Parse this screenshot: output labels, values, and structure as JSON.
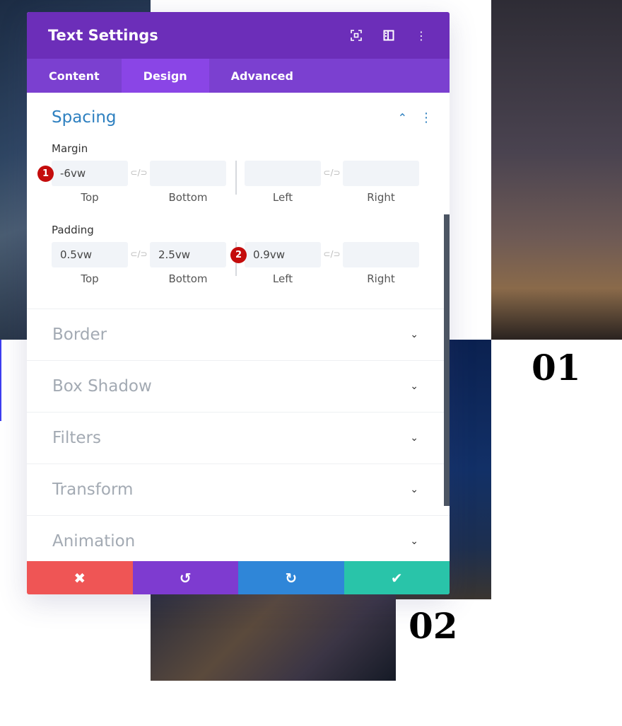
{
  "panel": {
    "title": "Text Settings",
    "header_icons": [
      "focus-icon",
      "split-view-icon",
      "more-options-icon"
    ]
  },
  "tabs": [
    {
      "label": "Content"
    },
    {
      "label": "Design",
      "active": true
    },
    {
      "label": "Advanced"
    }
  ],
  "spacing": {
    "title": "Spacing",
    "margin": {
      "label": "Margin",
      "top": "-6vw",
      "bottom": "",
      "left": "",
      "right": "",
      "badge": "1"
    },
    "padding": {
      "label": "Padding",
      "top": "0.5vw",
      "bottom": "2.5vw",
      "left": "0.9vw",
      "right": "",
      "badge": "2"
    },
    "sublabels": {
      "top": "Top",
      "bottom": "Bottom",
      "left": "Left",
      "right": "Right"
    }
  },
  "sections": [
    {
      "title": "Border"
    },
    {
      "title": "Box Shadow"
    },
    {
      "title": "Filters"
    },
    {
      "title": "Transform"
    },
    {
      "title": "Animation"
    }
  ],
  "footer": {
    "cancel_color": "#ef5555",
    "undo_color": "#7e3bd0",
    "redo_color": "#2f86d8",
    "save_color": "#29c4a9"
  },
  "background": {
    "label_01": "01",
    "label_02": "02"
  },
  "colors": {
    "header": "#6c2eb9",
    "tabs": "#7b40d0",
    "active_tab": "#8a45e6",
    "accent": "#2e80c0",
    "badge": "#c40c0c"
  }
}
